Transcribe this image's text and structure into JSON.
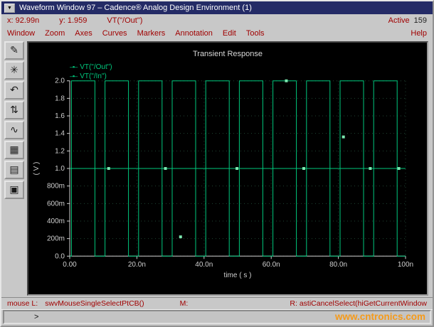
{
  "window": {
    "title": "Waveform Window 97 – Cadence® Analog Design Environment (1)",
    "menu_icon": "▼"
  },
  "status_row": {
    "x_label": "x: 92.99n",
    "y_label": "y: 1.959",
    "trace_label": "VT(\"/Out\")",
    "active_label": "Active",
    "active_value": "159"
  },
  "menu": {
    "items": [
      "Window",
      "Zoom",
      "Axes",
      "Curves",
      "Markers",
      "Annotation",
      "Edit",
      "Tools"
    ],
    "help": "Help"
  },
  "toolbar": {
    "icons": [
      {
        "name": "annotate-pen-icon",
        "glyph": "✎"
      },
      {
        "name": "zoom-fit-icon",
        "glyph": "✳"
      },
      {
        "name": "previous-view-icon",
        "glyph": "↶"
      },
      {
        "name": "vertical-marker-icon",
        "glyph": "⇅"
      },
      {
        "name": "edit-trace-icon",
        "glyph": "∿"
      },
      {
        "name": "data-table-icon",
        "glyph": "▦"
      },
      {
        "name": "strip-chart-icon",
        "glyph": "▤"
      },
      {
        "name": "subwindow-icon",
        "glyph": "▣"
      }
    ]
  },
  "plot": {
    "title": "Transient Response",
    "legend": [
      {
        "marker": "–▪–",
        "label": "VT(\"/Out\")"
      },
      {
        "marker": "–▪–",
        "label": "VT(\"/In\")"
      }
    ]
  },
  "colors": {
    "trace_green": "#00c87d",
    "handle_green": "#7de8b0",
    "menu_red": "#a00000",
    "titlebar_blue": "#242b66",
    "plot_bg": "#000000",
    "watermark_orange": "#f59a1a",
    "axis_gray": "#cfcfcf"
  },
  "chart_data": {
    "type": "line",
    "title": "Transient Response",
    "xlabel": "time ( s )",
    "ylabel": "( V )",
    "xlim": [
      0,
      100
    ],
    "ylim": [
      0,
      2.0
    ],
    "x_unit": "ns",
    "grid": true,
    "x_ticks": [
      "0.00",
      "20.0n",
      "40.0n",
      "60.0n",
      "80.0n",
      "100n"
    ],
    "x_tick_values": [
      0,
      20,
      40,
      60,
      80,
      100
    ],
    "y_ticks": [
      "2.0",
      "1.8",
      "1.6",
      "1.4",
      "1.2",
      "1.0",
      "800m",
      "600m",
      "400m",
      "200m",
      "0.0"
    ],
    "y_tick_values": [
      2.0,
      1.8,
      1.6,
      1.4,
      1.2,
      1.0,
      0.8,
      0.6,
      0.4,
      0.2,
      0.0
    ],
    "series": [
      {
        "name": "VT(\"/Out\")",
        "color": "#00c87d",
        "waveform": "pulse",
        "v_low": 0.0,
        "v_high": 2.0,
        "period": 10,
        "rise_at": 0.5,
        "fall_at": 7.5
      },
      {
        "name": "VT(\"/In\")",
        "color": "#00c87d",
        "waveform": "dc",
        "value": 1.0
      }
    ],
    "handle_color": "#7de8b0",
    "selection_handles": [
      [
        11.6,
        1.0
      ],
      [
        28.5,
        1.0
      ],
      [
        33.0,
        0.22
      ],
      [
        49.8,
        1.0
      ],
      [
        64.5,
        2.0
      ],
      [
        69.7,
        1.0
      ],
      [
        81.5,
        1.36
      ],
      [
        89.5,
        1.0
      ],
      [
        98.0,
        1.0
      ]
    ]
  },
  "status_bar": {
    "mouse_l": "mouse L:",
    "mouse_l_cmd": "swvMouseSingleSelectPtCB()",
    "mouse_m": "M:",
    "mouse_r": "R: astiCancelSelect(hiGetCurrentWindow",
    "prompt": ">",
    "watermark": "www.cntronics.com"
  }
}
